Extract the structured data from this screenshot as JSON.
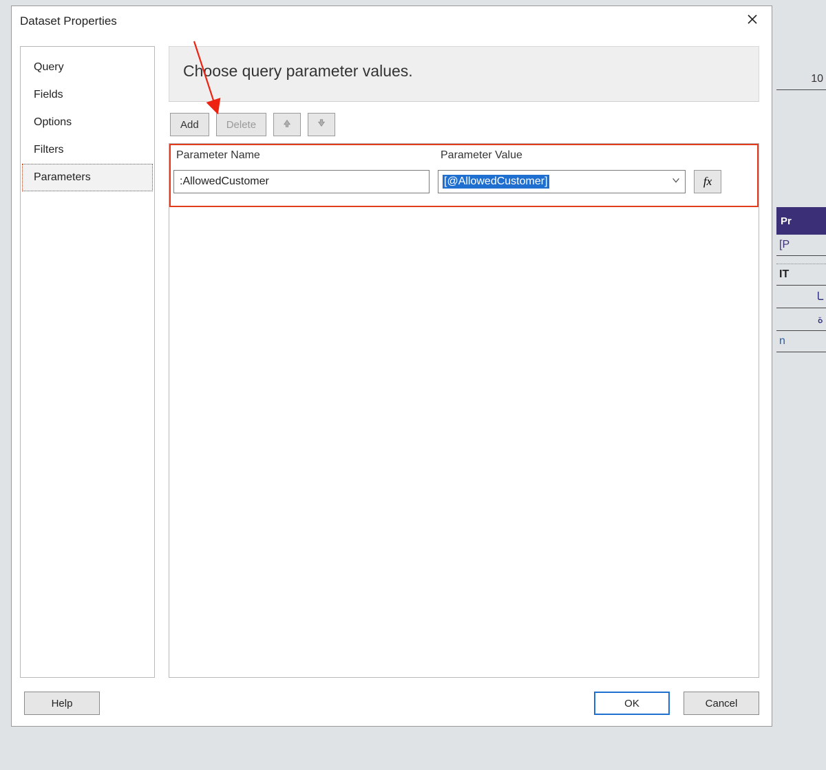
{
  "dialog": {
    "title": "Dataset Properties"
  },
  "sidebar": {
    "items": [
      {
        "label": "Query"
      },
      {
        "label": "Fields"
      },
      {
        "label": "Options"
      },
      {
        "label": "Filters"
      },
      {
        "label": "Parameters",
        "selected": true
      }
    ]
  },
  "main": {
    "banner": "Choose query parameter values.",
    "toolbar": {
      "add": "Add",
      "delete": "Delete"
    },
    "columns": {
      "name": "Parameter Name",
      "value": "Parameter Value"
    },
    "rows": [
      {
        "name": ":AllowedCustomer",
        "value": "[@AllowedCustomer]"
      }
    ],
    "fx": "fx"
  },
  "footer": {
    "help": "Help",
    "ok": "OK",
    "cancel": "Cancel"
  },
  "background": {
    "right": {
      "num10": "10",
      "pr": "Pr",
      "p": "[P",
      "it": "IT",
      "ar1": "ـا",
      "ar2": "ة",
      "n": "n"
    }
  }
}
